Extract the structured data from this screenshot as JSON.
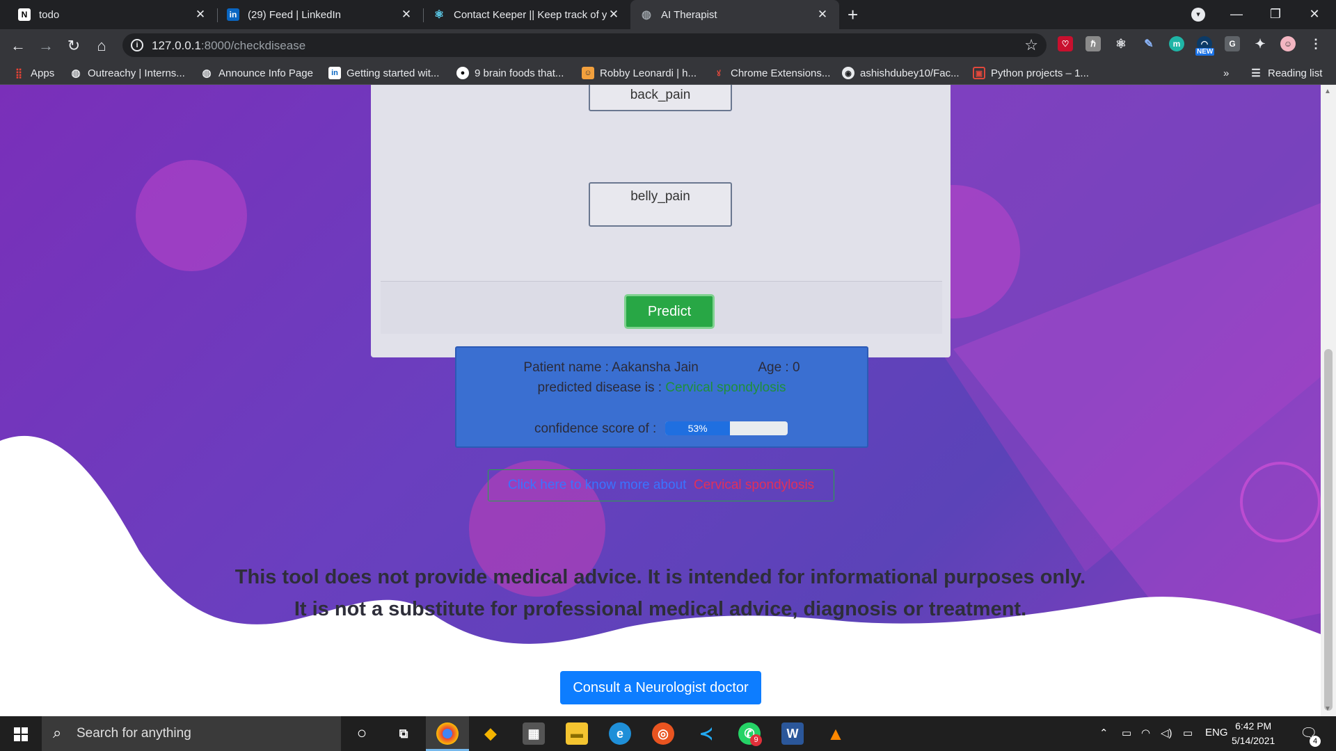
{
  "browser": {
    "tabs": [
      {
        "title": "todo",
        "favicon": "notion-icon"
      },
      {
        "title": "(29) Feed | LinkedIn",
        "favicon": "linkedin-icon"
      },
      {
        "title": "Contact Keeper || Keep track of y",
        "favicon": "react-icon"
      },
      {
        "title": "AI Therapist",
        "favicon": "globe-icon"
      }
    ],
    "url_host": "127.0.0.1",
    "url_path": ":8000/checkdisease",
    "ext_new_badge": "NEW",
    "bookmarks": [
      "Apps",
      "Outreachy | Interns...",
      "Announce Info Page",
      "Getting started wit...",
      "9 brain foods that...",
      "Robby Leonardi | h...",
      "Chrome Extensions...",
      "ashishdubey10/Fac...",
      "Python projects – 1..."
    ],
    "reading_list": "Reading list",
    "more_bookmarks": "»"
  },
  "page": {
    "symptoms": [
      "back_pain",
      "belly_pain"
    ],
    "predict_button": "Predict",
    "result": {
      "patient_label": "Patient name : ",
      "patient_name": "Aakansha Jain",
      "age_label": "Age : ",
      "age": "0",
      "predicted_label": "predicted disease is : ",
      "disease": "Cervical spondylosis",
      "confidence_label": "confidence score of : ",
      "confidence_text": "53%",
      "confidence_value": 0.53
    },
    "more_link_prefix": "Click here to know more about",
    "more_link_disease": "Cervical spondylosis",
    "disclaimer_line1": "This tool does not provide medical advice. It is intended for informational purposes only.",
    "disclaimer_line2": "It is not a substitute for professional medical advice, diagnosis or treatment.",
    "consult_button": "Consult a Neurologist doctor"
  },
  "taskbar": {
    "search_placeholder": "Search for anything",
    "language": "ENG",
    "time": "6:42 PM",
    "date": "5/14/2021",
    "notification_count": "4",
    "whatsapp_badge": "9"
  }
}
